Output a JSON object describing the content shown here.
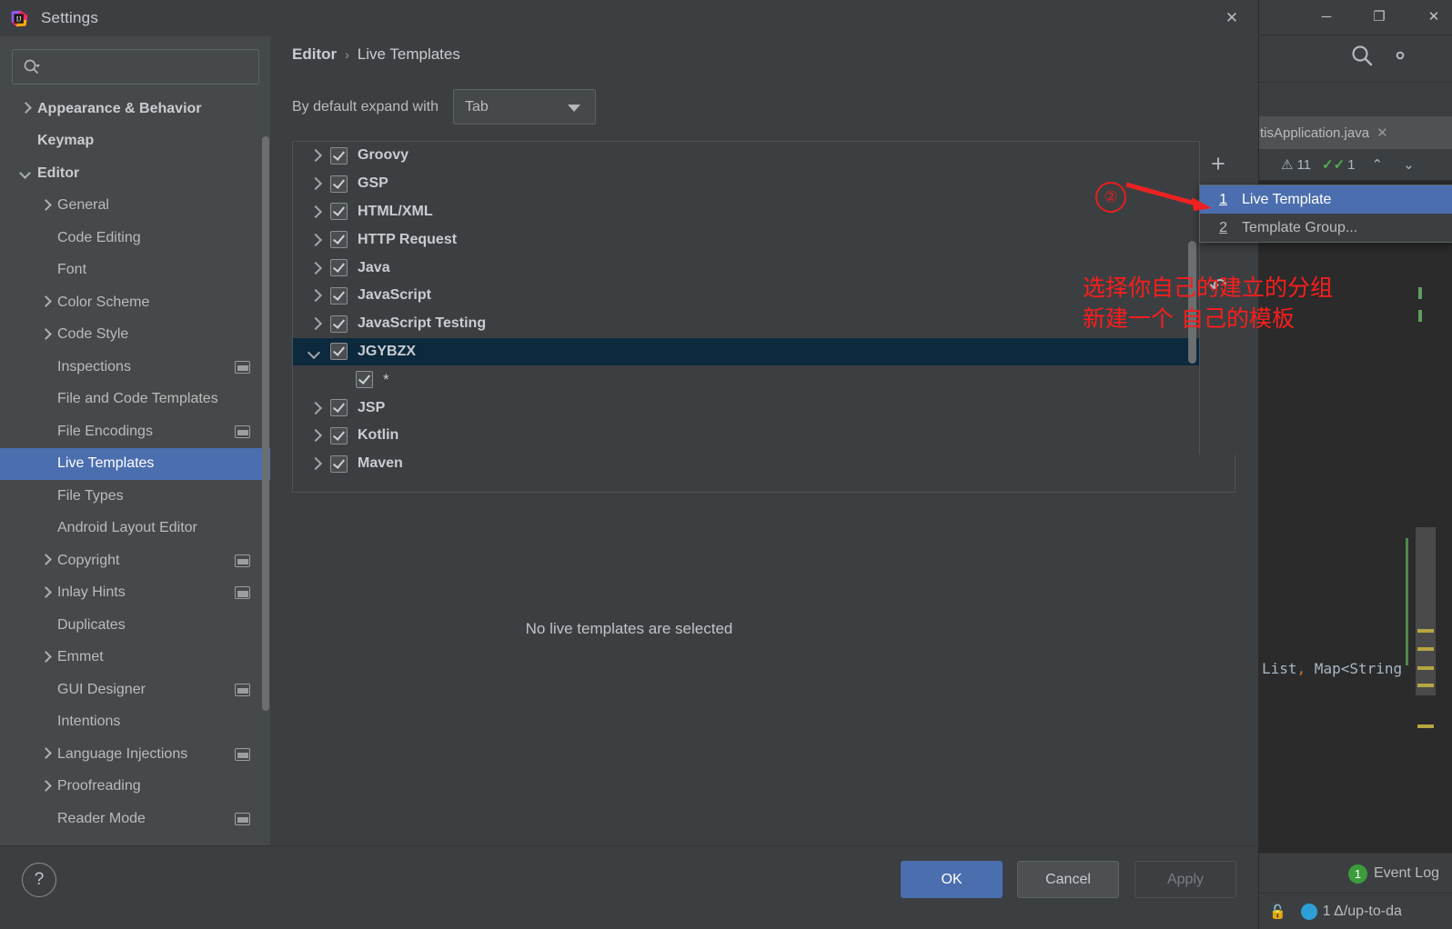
{
  "ide": {
    "window_controls": [
      "─",
      "❐",
      "✕"
    ],
    "search_icon": "search-icon",
    "gear_icon": "gear-icon",
    "open_tab": "tisApplication.java",
    "tab_close": "✕",
    "inspection_warnings": "11",
    "inspection_checks": "1",
    "nav_up": "⌃",
    "nav_down": "⌄",
    "code_snippet_a": "List",
    "code_snippet_comma": ",",
    "code_snippet_b": " Map<String",
    "event_log_count": "1",
    "event_log_label": "Event Log",
    "status_text": "1 Δ/up-to-da"
  },
  "dialog": {
    "title": "Settings",
    "icon": "intellij-idea-icon",
    "close": "✕",
    "search": {
      "placeholder": "",
      "value": "",
      "icon": "search-dropdown-icon"
    },
    "sidebar": {
      "items": [
        {
          "label": "Appearance & Behavior",
          "arrow": "right",
          "indent": 0,
          "bold": true,
          "badge": false,
          "selected": false
        },
        {
          "label": "Keymap",
          "arrow": "none",
          "indent": 0,
          "bold": true,
          "badge": false,
          "selected": false
        },
        {
          "label": "Editor",
          "arrow": "down",
          "indent": 0,
          "bold": true,
          "badge": false,
          "selected": false
        },
        {
          "label": "General",
          "arrow": "right",
          "indent": 1,
          "bold": false,
          "badge": false,
          "selected": false
        },
        {
          "label": "Code Editing",
          "arrow": "none",
          "indent": 1,
          "bold": false,
          "badge": false,
          "selected": false
        },
        {
          "label": "Font",
          "arrow": "none",
          "indent": 1,
          "bold": false,
          "badge": false,
          "selected": false
        },
        {
          "label": "Color Scheme",
          "arrow": "right",
          "indent": 1,
          "bold": false,
          "badge": false,
          "selected": false
        },
        {
          "label": "Code Style",
          "arrow": "right",
          "indent": 1,
          "bold": false,
          "badge": false,
          "selected": false
        },
        {
          "label": "Inspections",
          "arrow": "none",
          "indent": 1,
          "bold": false,
          "badge": true,
          "selected": false
        },
        {
          "label": "File and Code Templates",
          "arrow": "none",
          "indent": 1,
          "bold": false,
          "badge": false,
          "selected": false
        },
        {
          "label": "File Encodings",
          "arrow": "none",
          "indent": 1,
          "bold": false,
          "badge": true,
          "selected": false
        },
        {
          "label": "Live Templates",
          "arrow": "none",
          "indent": 1,
          "bold": false,
          "badge": false,
          "selected": true
        },
        {
          "label": "File Types",
          "arrow": "none",
          "indent": 1,
          "bold": false,
          "badge": false,
          "selected": false
        },
        {
          "label": "Android Layout Editor",
          "arrow": "none",
          "indent": 1,
          "bold": false,
          "badge": false,
          "selected": false
        },
        {
          "label": "Copyright",
          "arrow": "right",
          "indent": 1,
          "bold": false,
          "badge": true,
          "selected": false
        },
        {
          "label": "Inlay Hints",
          "arrow": "right",
          "indent": 1,
          "bold": false,
          "badge": true,
          "selected": false
        },
        {
          "label": "Duplicates",
          "arrow": "none",
          "indent": 1,
          "bold": false,
          "badge": false,
          "selected": false
        },
        {
          "label": "Emmet",
          "arrow": "right",
          "indent": 1,
          "bold": false,
          "badge": false,
          "selected": false
        },
        {
          "label": "GUI Designer",
          "arrow": "none",
          "indent": 1,
          "bold": false,
          "badge": true,
          "selected": false
        },
        {
          "label": "Intentions",
          "arrow": "none",
          "indent": 1,
          "bold": false,
          "badge": false,
          "selected": false
        },
        {
          "label": "Language Injections",
          "arrow": "right",
          "indent": 1,
          "bold": false,
          "badge": true,
          "selected": false
        },
        {
          "label": "Proofreading",
          "arrow": "right",
          "indent": 1,
          "bold": false,
          "badge": false,
          "selected": false
        },
        {
          "label": "Reader Mode",
          "arrow": "none",
          "indent": 1,
          "bold": false,
          "badge": true,
          "selected": false
        }
      ]
    },
    "main": {
      "breadcrumb": {
        "parent": "Editor",
        "separator": "›",
        "current": "Live Templates"
      },
      "expand_with": {
        "label": "By default expand with",
        "value": "Tab"
      },
      "tree": [
        {
          "label": "Groovy",
          "arrow": "right",
          "checked": true,
          "child": false,
          "selected": false
        },
        {
          "label": "GSP",
          "arrow": "right",
          "checked": true,
          "child": false,
          "selected": false
        },
        {
          "label": "HTML/XML",
          "arrow": "right",
          "checked": true,
          "child": false,
          "selected": false
        },
        {
          "label": "HTTP Request",
          "arrow": "right",
          "checked": true,
          "child": false,
          "selected": false
        },
        {
          "label": "Java",
          "arrow": "right",
          "checked": true,
          "child": false,
          "selected": false
        },
        {
          "label": "JavaScript",
          "arrow": "right",
          "checked": true,
          "child": false,
          "selected": false
        },
        {
          "label": "JavaScript Testing",
          "arrow": "right",
          "checked": true,
          "child": false,
          "selected": false
        },
        {
          "label": "JGYBZX",
          "arrow": "down",
          "checked": true,
          "child": false,
          "selected": true
        },
        {
          "label": "*",
          "arrow": "none",
          "checked": true,
          "child": true,
          "selected": false
        },
        {
          "label": "JSP",
          "arrow": "right",
          "checked": true,
          "child": false,
          "selected": false
        },
        {
          "label": "Kotlin",
          "arrow": "right",
          "checked": true,
          "child": false,
          "selected": false
        },
        {
          "label": "Maven",
          "arrow": "right",
          "checked": true,
          "child": false,
          "selected": false
        }
      ],
      "toolbar": {
        "add": "+",
        "revert": "↶"
      },
      "context_menu": [
        {
          "num": "1",
          "label": "Live Template",
          "selected": true
        },
        {
          "num": "2",
          "label": "Template Group...",
          "selected": false
        }
      ],
      "empty_message": "No live templates are selected"
    },
    "annotations": {
      "marker": "②",
      "note_line1": "选择你自己的建立的分组",
      "note_line2": "新建一个 自己的模板",
      "color": "#fb1d1d"
    },
    "buttons": {
      "help": "?",
      "ok": "OK",
      "cancel": "Cancel",
      "apply": "Apply"
    }
  }
}
